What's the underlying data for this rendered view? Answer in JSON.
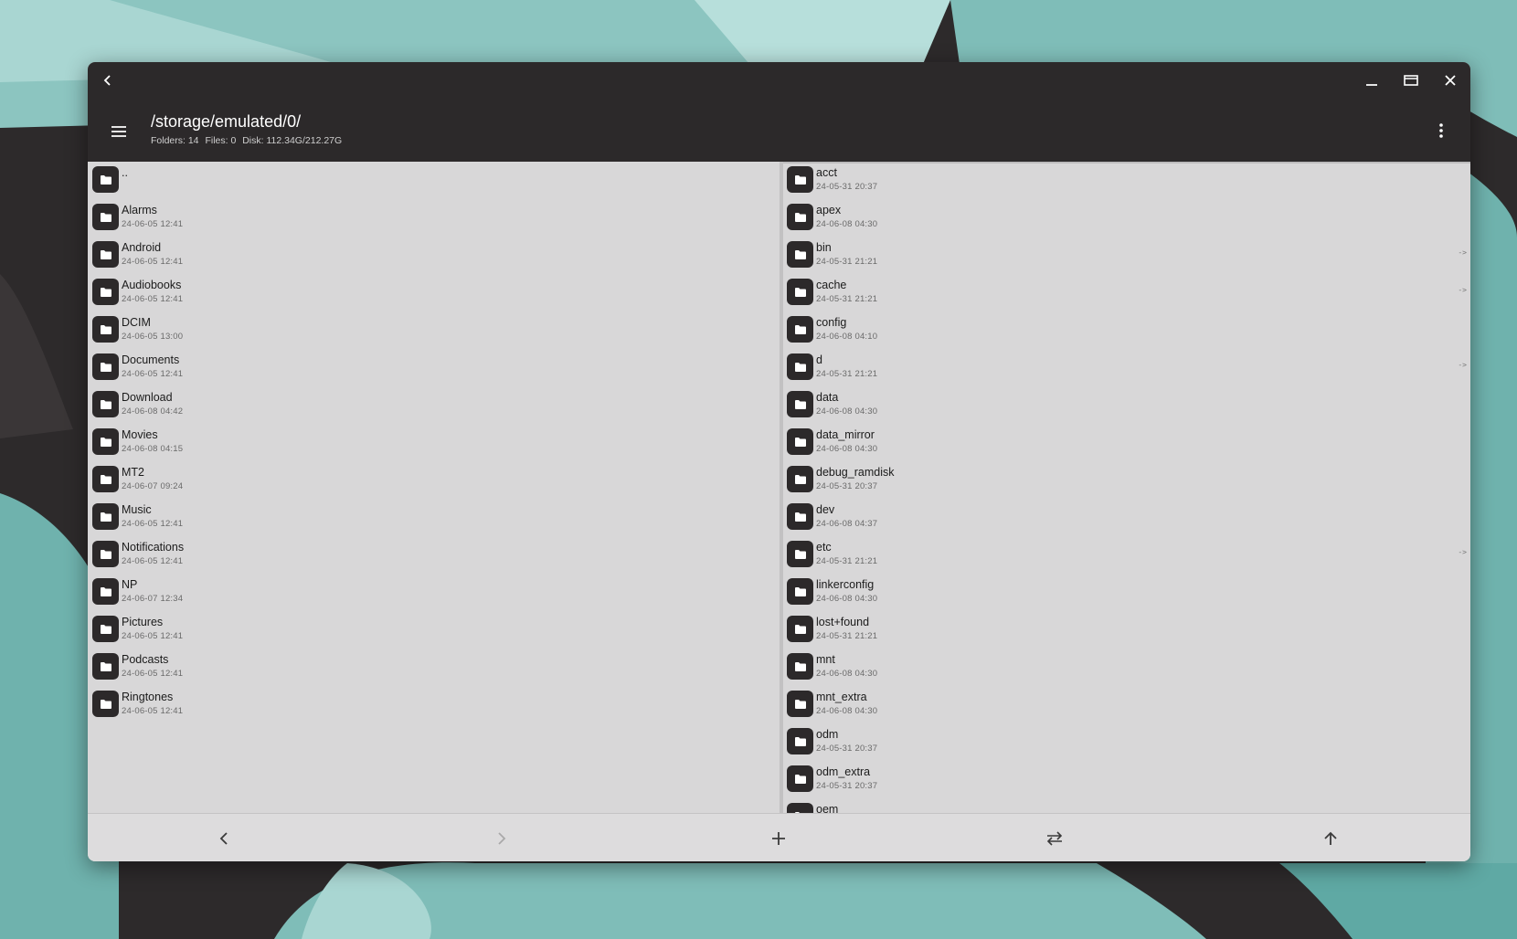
{
  "colors": {
    "titlebar": "#2c292a",
    "pane_bg": "#d8d7d8",
    "wall_teal": "#7fbdb8",
    "wall_light": "#a8d5d1",
    "wall_dark": "#2d2a2b"
  },
  "titlebar": {
    "back_icon": "chevron-left-icon",
    "minimize_icon": "minimize-icon",
    "maximize_icon": "maximize-icon",
    "close_icon": "close-icon"
  },
  "header": {
    "path": "/storage/emulated/0/",
    "folders_label": "Folders: 14",
    "files_label": "Files: 0",
    "disk_label": "Disk: 112.34G/212.27G",
    "menu_icon": "hamburger-menu-icon",
    "more_icon": "more-vertical-icon"
  },
  "left_pane": {
    "items": [
      {
        "name": "..",
        "date": ""
      },
      {
        "name": "Alarms",
        "date": "24-06-05 12:41"
      },
      {
        "name": "Android",
        "date": "24-06-05 12:41"
      },
      {
        "name": "Audiobooks",
        "date": "24-06-05 12:41"
      },
      {
        "name": "DCIM",
        "date": "24-06-05 13:00"
      },
      {
        "name": "Documents",
        "date": "24-06-05 12:41"
      },
      {
        "name": "Download",
        "date": "24-06-08 04:42"
      },
      {
        "name": "Movies",
        "date": "24-06-08 04:15"
      },
      {
        "name": "MT2",
        "date": "24-06-07 09:24"
      },
      {
        "name": "Music",
        "date": "24-06-05 12:41"
      },
      {
        "name": "Notifications",
        "date": "24-06-05 12:41"
      },
      {
        "name": "NP",
        "date": "24-06-07 12:34"
      },
      {
        "name": "Pictures",
        "date": "24-06-05 12:41"
      },
      {
        "name": "Podcasts",
        "date": "24-06-05 12:41"
      },
      {
        "name": "Ringtones",
        "date": "24-06-05 12:41"
      }
    ]
  },
  "right_pane": {
    "items": [
      {
        "name": "acct",
        "date": "24-05-31 20:37",
        "link": ""
      },
      {
        "name": "apex",
        "date": "24-06-08 04:30",
        "link": ""
      },
      {
        "name": "bin",
        "date": "24-05-31 21:21",
        "link": "->"
      },
      {
        "name": "cache",
        "date": "24-05-31 21:21",
        "link": "->"
      },
      {
        "name": "config",
        "date": "24-06-08 04:10",
        "link": ""
      },
      {
        "name": "d",
        "date": "24-05-31 21:21",
        "link": "->"
      },
      {
        "name": "data",
        "date": "24-06-08 04:30",
        "link": ""
      },
      {
        "name": "data_mirror",
        "date": "24-06-08 04:30",
        "link": ""
      },
      {
        "name": "debug_ramdisk",
        "date": "24-05-31 20:37",
        "link": ""
      },
      {
        "name": "dev",
        "date": "24-06-08 04:37",
        "link": ""
      },
      {
        "name": "etc",
        "date": "24-05-31 21:21",
        "link": "->"
      },
      {
        "name": "linkerconfig",
        "date": "24-06-08 04:30",
        "link": ""
      },
      {
        "name": "lost+found",
        "date": "24-05-31 21:21",
        "link": ""
      },
      {
        "name": "mnt",
        "date": "24-06-08 04:30",
        "link": ""
      },
      {
        "name": "mnt_extra",
        "date": "24-06-08 04:30",
        "link": ""
      },
      {
        "name": "odm",
        "date": "24-05-31 20:37",
        "link": ""
      },
      {
        "name": "odm_extra",
        "date": "24-05-31 20:37",
        "link": ""
      },
      {
        "name": "oem",
        "date": "",
        "link": ""
      }
    ]
  },
  "bottombar": {
    "back_icon": "arrow-back-icon",
    "forward_icon": "arrow-forward-icon",
    "add_icon": "plus-icon",
    "swap_icon": "swap-panes-icon",
    "up_icon": "arrow-up-icon"
  }
}
